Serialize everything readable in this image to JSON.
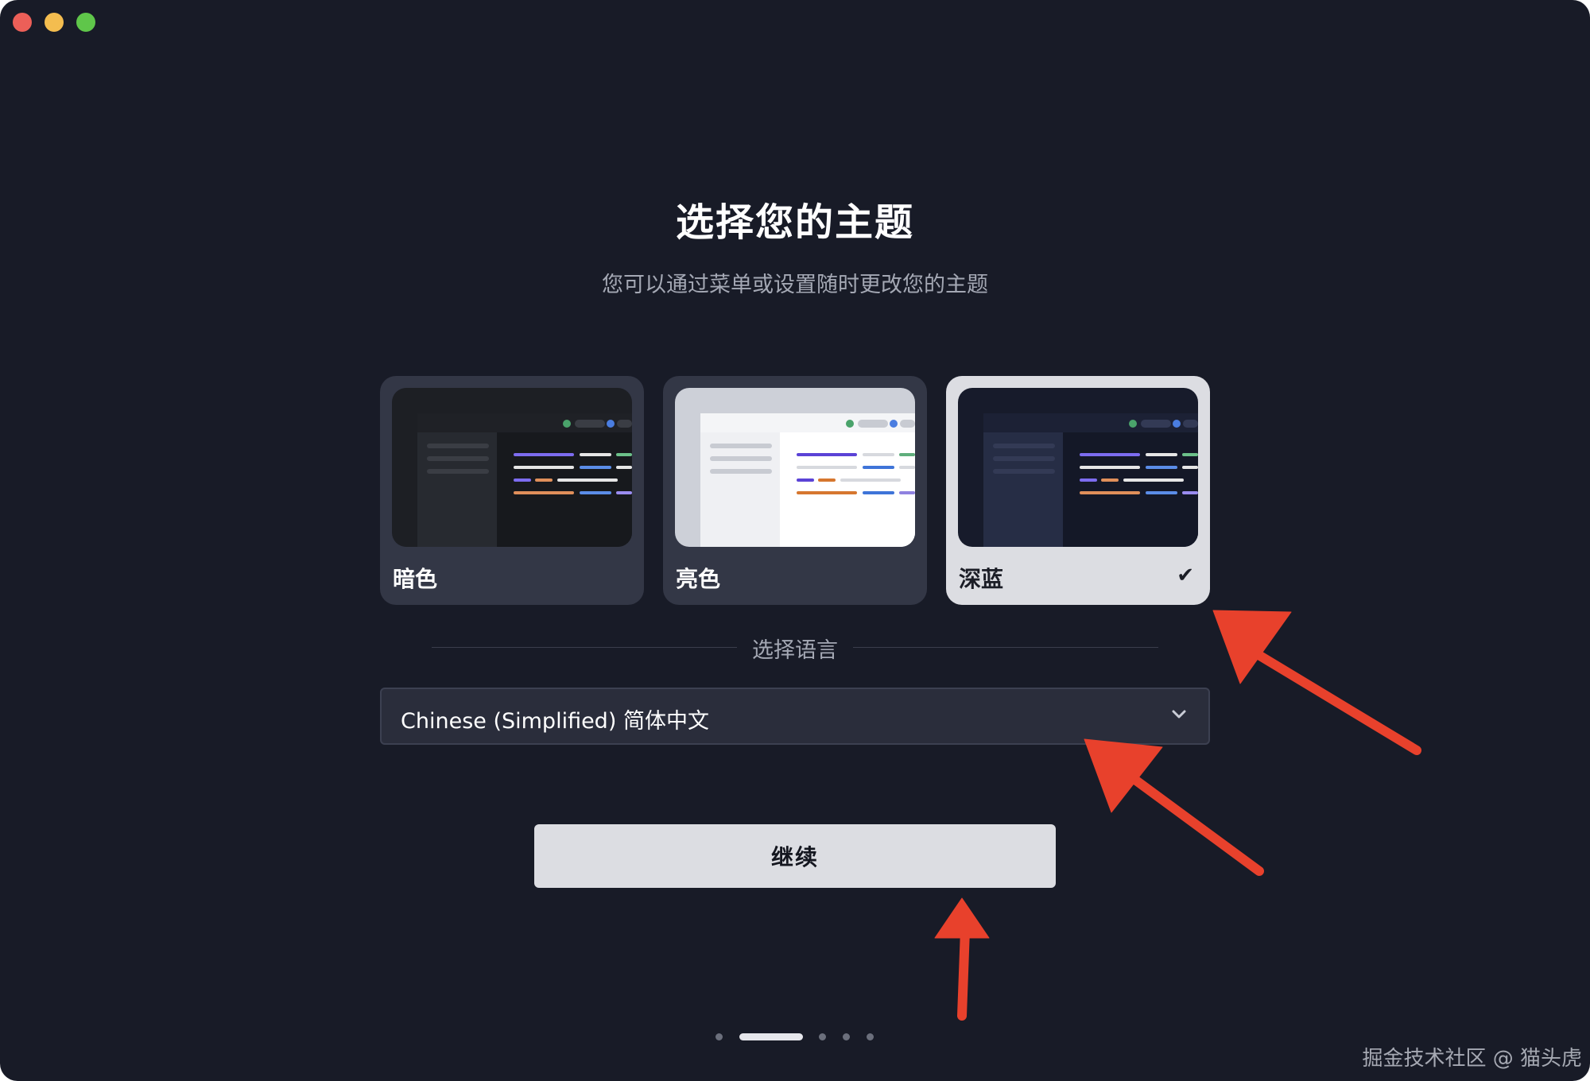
{
  "window": {
    "controls": [
      "close",
      "minimize",
      "maximize"
    ]
  },
  "header": {
    "title": "选择您的主题",
    "subtitle": "您可以通过菜单或设置随时更改您的主题"
  },
  "themes": [
    {
      "label": "暗色",
      "selected": false
    },
    {
      "label": "亮色",
      "selected": false
    },
    {
      "label": "深蓝",
      "selected": true,
      "check": "✔"
    }
  ],
  "language": {
    "label": "选择语言",
    "selected": "Chinese (Simplified) 简体中文"
  },
  "actions": {
    "continue_label": "继续"
  },
  "pager": {
    "total": 5,
    "current": 2
  },
  "watermark": "掘金技术社区 @ 猫头虎",
  "colors": {
    "background": "#181b27",
    "card": "#333746",
    "selected_card": "#dcdde2",
    "annotation_arrow": "#e8412c"
  }
}
